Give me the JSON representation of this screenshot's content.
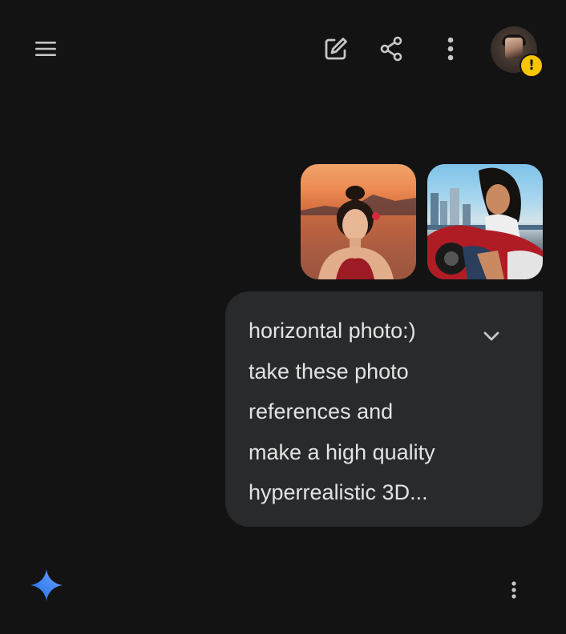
{
  "header": {
    "menu_icon": "menu-icon",
    "new_chat_icon": "edit-icon",
    "share_icon": "share-icon",
    "more_icon": "more-vert-icon",
    "avatar_badge": "!",
    "badge_color": "#f9c400"
  },
  "prompt": {
    "attachments": [
      {
        "icon": "image-thumbnail"
      },
      {
        "icon": "image-thumbnail"
      }
    ],
    "lines": [
      "horizontal photo:)",
      "take these photo",
      "references and",
      "make a high quality",
      "hyperrealistic 3D..."
    ],
    "expand_icon": "chevron-down-icon"
  },
  "response": {
    "logo_icon": "gemini-sparkle-icon",
    "more_icon": "more-vert-icon",
    "accent": "#4285f4"
  }
}
